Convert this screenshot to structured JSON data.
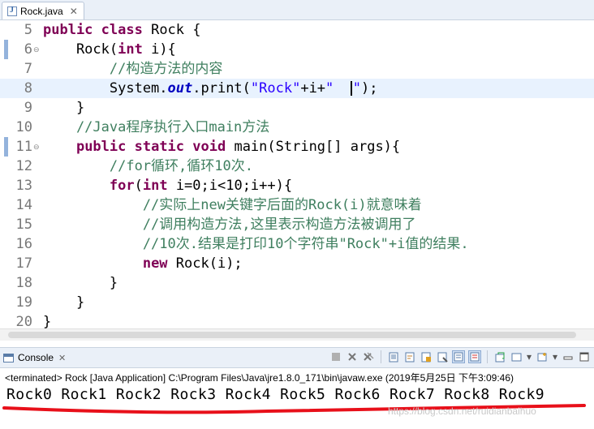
{
  "editor_tab": {
    "label": "Rock.java",
    "close": "✕"
  },
  "code_lines": [
    {
      "num": "5",
      "parts": [
        [
          "kw",
          "public "
        ],
        [
          "kw",
          "class "
        ],
        [
          "p",
          "Rock {"
        ]
      ]
    },
    {
      "num": "6",
      "fold": "⊖",
      "parts": [
        [
          "p",
          "    Rock("
        ],
        [
          "kw",
          "int "
        ],
        [
          "p",
          "i){"
        ]
      ]
    },
    {
      "num": "7",
      "parts": [
        [
          "cm",
          "        //构造方法的内容"
        ]
      ]
    },
    {
      "num": "8",
      "current": true,
      "parts": [
        [
          "p",
          "        System."
        ],
        [
          "fld",
          "out"
        ],
        [
          "p",
          ".print("
        ],
        [
          "str",
          "\"Rock\""
        ],
        [
          "p",
          "+i+"
        ],
        [
          "str",
          "\"  "
        ],
        [
          "cursor",
          ""
        ],
        [
          "str",
          "\""
        ],
        [
          "p",
          ");"
        ]
      ]
    },
    {
      "num": "9",
      "parts": [
        [
          "p",
          "    }"
        ]
      ]
    },
    {
      "num": "10",
      "parts": [
        [
          "cm",
          "    //Java程序执行入口main方法"
        ]
      ]
    },
    {
      "num": "11",
      "fold": "⊖",
      "parts": [
        [
          "p",
          "    "
        ],
        [
          "kw",
          "public "
        ],
        [
          "kw",
          "static "
        ],
        [
          "kw",
          "void "
        ],
        [
          "p",
          "main(String[] args){"
        ]
      ]
    },
    {
      "num": "12",
      "parts": [
        [
          "cm",
          "        //for循环,循环10次."
        ]
      ]
    },
    {
      "num": "13",
      "parts": [
        [
          "p",
          "        "
        ],
        [
          "kw",
          "for"
        ],
        [
          "p",
          "("
        ],
        [
          "kw",
          "int "
        ],
        [
          "p",
          "i=0;i<10;i++){"
        ]
      ]
    },
    {
      "num": "14",
      "parts": [
        [
          "cm",
          "            //实际上new关键字后面的Rock(i)就意味着"
        ]
      ]
    },
    {
      "num": "15",
      "parts": [
        [
          "cm",
          "            //调用构造方法,这里表示构造方法被调用了"
        ]
      ]
    },
    {
      "num": "16",
      "parts": [
        [
          "cm",
          "            //10次.结果是打印10个字符串\"Rock\"+i值的结果."
        ]
      ]
    },
    {
      "num": "17",
      "parts": [
        [
          "p",
          "            "
        ],
        [
          "kw",
          "new "
        ],
        [
          "p",
          "Rock(i);"
        ]
      ]
    },
    {
      "num": "18",
      "parts": [
        [
          "p",
          "        }"
        ]
      ]
    },
    {
      "num": "19",
      "parts": [
        [
          "p",
          "    }"
        ]
      ]
    },
    {
      "num": "20",
      "parts": [
        [
          "p",
          "}"
        ]
      ]
    }
  ],
  "console": {
    "tab_label": "Console",
    "close": "✕",
    "terminated": "<terminated> Rock [Java Application] C:\\Program Files\\Java\\jre1.8.0_171\\bin\\javaw.exe (2019年5月25日 下午3:09:46)",
    "output": "Rock0 Rock1 Rock2 Rock3 Rock4 Rock5 Rock6 Rock7 Rock8 Rock9",
    "toolbar_icons": [
      "terminate-icon",
      "remove-launch-icon",
      "remove-all-icon",
      "scroll-lock-icon",
      "word-wrap-icon",
      "show-on-output-icon",
      "show-on-error-icon",
      "pin-console-icon",
      "display-console-icon",
      "dropdown-icon",
      "new-console-icon",
      "dropdown-icon",
      "minimize-icon",
      "maximize-icon"
    ]
  },
  "watermark": "https://blog.csdn.net/ruidianbaihuo",
  "colors": {
    "keyword": "#7f0055",
    "comment": "#3f7f5f",
    "string": "#2a00ff",
    "field": "#0000c0",
    "current_line": "#e8f2fe",
    "underline": "#e8101a"
  }
}
